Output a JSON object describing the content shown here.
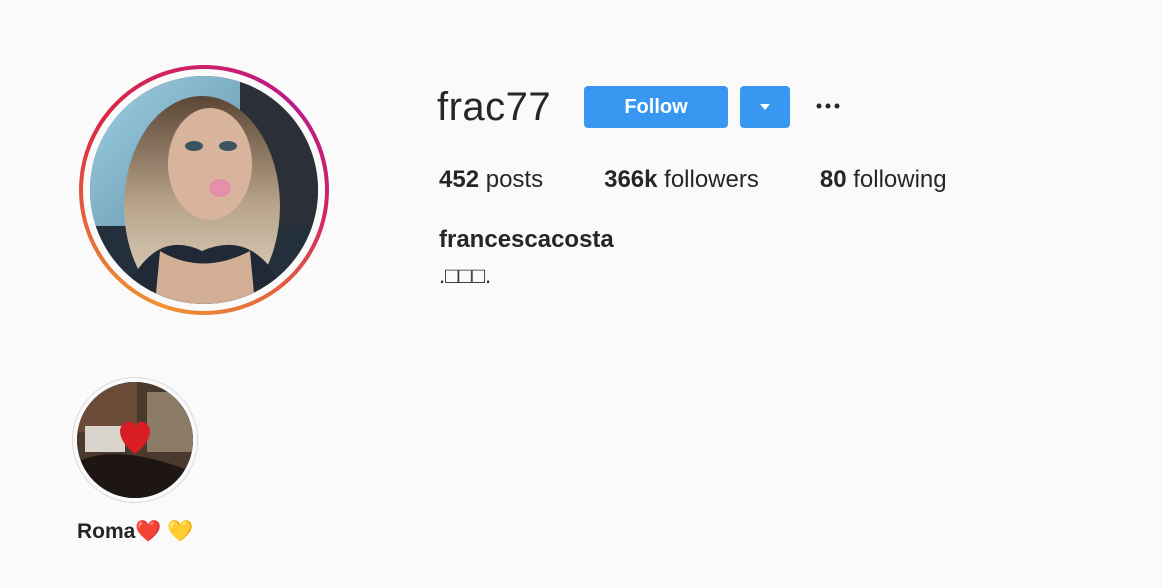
{
  "profile": {
    "username": "frac77",
    "follow_label": "Follow",
    "dropdown_icon": "caret-down-icon",
    "more_icon": "ellipsis-icon",
    "full_name": "francescacosta",
    "bio": ".□□□."
  },
  "stats": {
    "posts_count": "452",
    "posts_label": "posts",
    "followers_count": "366k",
    "followers_label": "followers",
    "following_count": "80",
    "following_label": "following"
  },
  "highlights": [
    {
      "label": "Roma❤️ 💛"
    }
  ],
  "colors": {
    "accent": "#3897f0",
    "text": "#262626",
    "background": "#fafafa",
    "ring_start": "#f09433",
    "ring_end": "#bc1888"
  }
}
